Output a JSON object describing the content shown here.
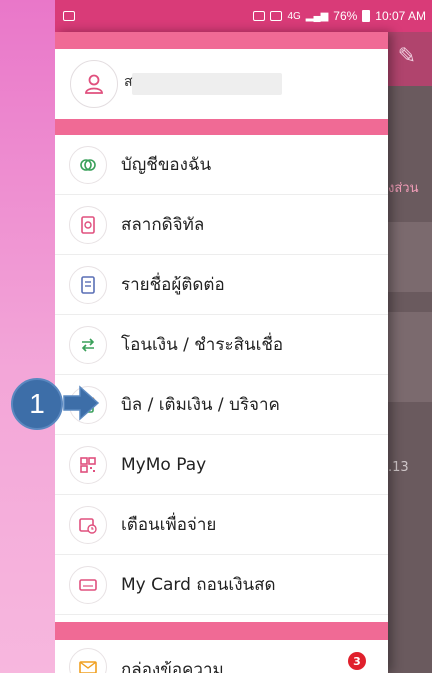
{
  "status_bar": {
    "network": "4G",
    "battery": "76%",
    "time": "10:07 AM"
  },
  "profile": {
    "name_visible_prefix": "ส"
  },
  "menu": {
    "items": [
      {
        "label": "บัญชีของฉัน",
        "icon": "coins-icon"
      },
      {
        "label": "สลากดิจิทัล",
        "icon": "lottery-ticket-icon"
      },
      {
        "label": "รายชื่อผู้ติดต่อ",
        "icon": "contacts-book-icon"
      },
      {
        "label": "โอนเงิน / ชำระสินเชื่อ",
        "icon": "transfer-arrows-icon"
      },
      {
        "label": "บิล / เติมเงิน / บริจาค",
        "icon": "bill-topup-icon"
      },
      {
        "label": "MyMo Pay",
        "icon": "qr-code-icon"
      },
      {
        "label": "เตือนเพื่อจ่าย",
        "icon": "calendar-clock-icon"
      },
      {
        "label": "My Card ถอนเงินสด",
        "icon": "atm-card-icon"
      }
    ],
    "inbox": {
      "label": "กล่องข้อความ",
      "badge": "3",
      "icon": "envelope-icon"
    }
  },
  "background": {
    "text1": "งส่วน",
    "text2": ".13"
  },
  "annotation": {
    "number": "1"
  },
  "colors": {
    "brand_pink": "#f06a95",
    "status_bar": "#d93b78",
    "icon_green": "#3aa05a",
    "icon_pink": "#e0507e",
    "icon_blue": "#5a6fb5",
    "badge_red": "#e0202c",
    "callout_blue": "#3d6ea8"
  }
}
